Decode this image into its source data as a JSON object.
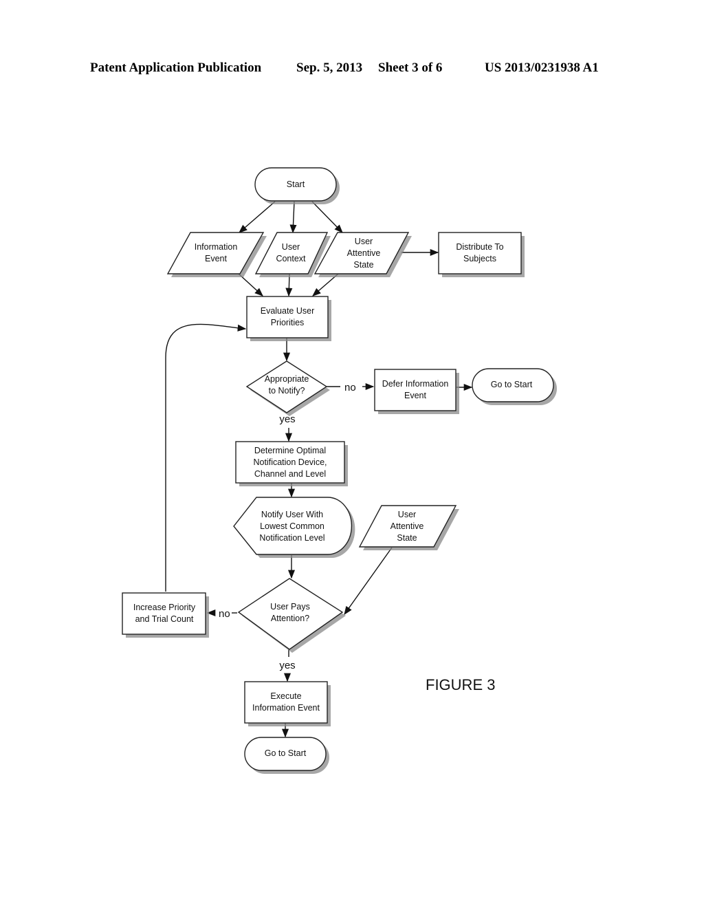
{
  "header": {
    "publication": "Patent Application Publication",
    "date": "Sep. 5, 2013",
    "sheet": "Sheet 3 of 6",
    "number": "US 2013/0231938 A1"
  },
  "figure_label": "FIGURE 3",
  "nodes": {
    "start": [
      "Start"
    ],
    "information_event": [
      "Information",
      "Event"
    ],
    "user_context": [
      "User",
      "Context"
    ],
    "user_attentive_state_top": [
      "User",
      "Attentive",
      "State"
    ],
    "distribute_to_subjects": [
      "Distribute To",
      "Subjects"
    ],
    "evaluate_user_priorities": [
      "Evaluate User",
      "Priorities"
    ],
    "appropriate_to_notify": [
      "Appropriate",
      "to Notify?"
    ],
    "defer_information_event": [
      "Defer Information",
      "Event"
    ],
    "go_to_start_right": [
      "Go to Start"
    ],
    "determine_optimal": [
      "Determine Optimal",
      "Notification Device,",
      "Channel and Level"
    ],
    "notify_user": [
      "Notify User With",
      "Lowest Common",
      "Notification Level"
    ],
    "user_attentive_state_bottom": [
      "User",
      "Attentive",
      "State"
    ],
    "user_pays_attention": [
      "User Pays",
      "Attention?"
    ],
    "increase_priority": [
      "Increase Priority",
      "and Trial Count"
    ],
    "execute_information_event": [
      "Execute",
      "Information Event"
    ],
    "go_to_start_bottom": [
      "Go to Start"
    ]
  },
  "edge_labels": {
    "appropriate_no": "no",
    "appropriate_yes": "yes",
    "attention_no": "no",
    "attention_yes": "yes"
  }
}
